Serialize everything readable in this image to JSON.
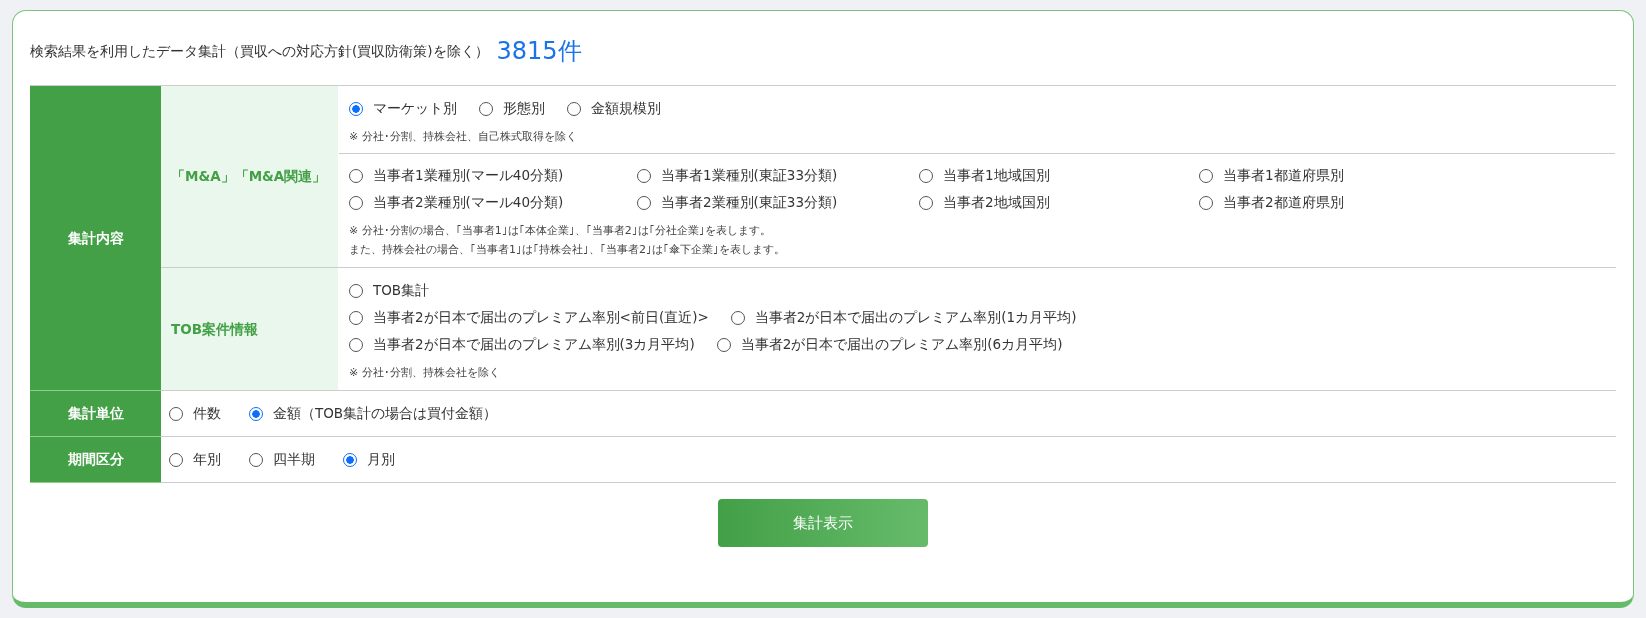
{
  "summary": {
    "label": "検索結果を利用したデータ集計（買収への対応方針(買収防衛策)を除く）",
    "count": "3815件"
  },
  "content": {
    "header": "集計内容",
    "groups": [
      {
        "label": "「M&A」「M&A関連」",
        "blocks": [
          {
            "lines": [
              {
                "options": [
                  {
                    "label": "マーケット別",
                    "selected": true
                  },
                  {
                    "label": "形態別",
                    "selected": false
                  },
                  {
                    "label": "金額規模別",
                    "selected": false
                  }
                ]
              }
            ],
            "notes": [
              "※ 分社･分割、持株会社、自己株式取得を除く"
            ]
          },
          {
            "lines": [
              {
                "options": [
                  {
                    "label": "当事者1業種別(マール40分類)",
                    "selected": false
                  },
                  {
                    "label": "当事者1業種別(東証33分類)",
                    "selected": false
                  },
                  {
                    "label": "当事者1地域国別",
                    "selected": false
                  },
                  {
                    "label": "当事者1都道府県別",
                    "selected": false
                  }
                ]
              },
              {
                "options": [
                  {
                    "label": "当事者2業種別(マール40分類)",
                    "selected": false
                  },
                  {
                    "label": "当事者2業種別(東証33分類)",
                    "selected": false
                  },
                  {
                    "label": "当事者2地域国別",
                    "selected": false
                  },
                  {
                    "label": "当事者2都道府県別",
                    "selected": false
                  }
                ]
              }
            ],
            "notes": [
              "※ 分社･分割の場合、｢当事者1｣は｢本体企業｣、｢当事者2｣は｢分社企業｣を表します。",
              "また、持株会社の場合、｢当事者1｣は｢持株会社｣、｢当事者2｣は｢傘下企業｣を表します。"
            ]
          }
        ]
      },
      {
        "label": "TOB案件情報",
        "blocks": [
          {
            "lines": [
              {
                "options": [
                  {
                    "label": "TOB集計",
                    "selected": false
                  }
                ]
              },
              {
                "options": [
                  {
                    "label": "当事者2が日本で届出のプレミアム率別<前日(直近)>",
                    "selected": false
                  },
                  {
                    "label": "当事者2が日本で届出のプレミアム率別(1カ月平均)",
                    "selected": false
                  }
                ]
              },
              {
                "options": [
                  {
                    "label": "当事者2が日本で届出のプレミアム率別(3カ月平均)",
                    "selected": false
                  },
                  {
                    "label": "当事者2が日本で届出のプレミアム率別(6カ月平均)",
                    "selected": false
                  }
                ]
              }
            ],
            "notes": [
              "※ 分社･分割、持株会社を除く"
            ]
          }
        ]
      }
    ]
  },
  "settings": [
    {
      "header": "集計単位",
      "options": [
        {
          "label": "件数",
          "selected": false
        },
        {
          "label": "金額（TOB集計の場合は買付金額）",
          "selected": true
        }
      ]
    },
    {
      "header": "期間区分",
      "options": [
        {
          "label": "年別",
          "selected": false
        },
        {
          "label": "四半期",
          "selected": false
        },
        {
          "label": "月別",
          "selected": true
        }
      ]
    }
  ],
  "submit": "集計表示"
}
